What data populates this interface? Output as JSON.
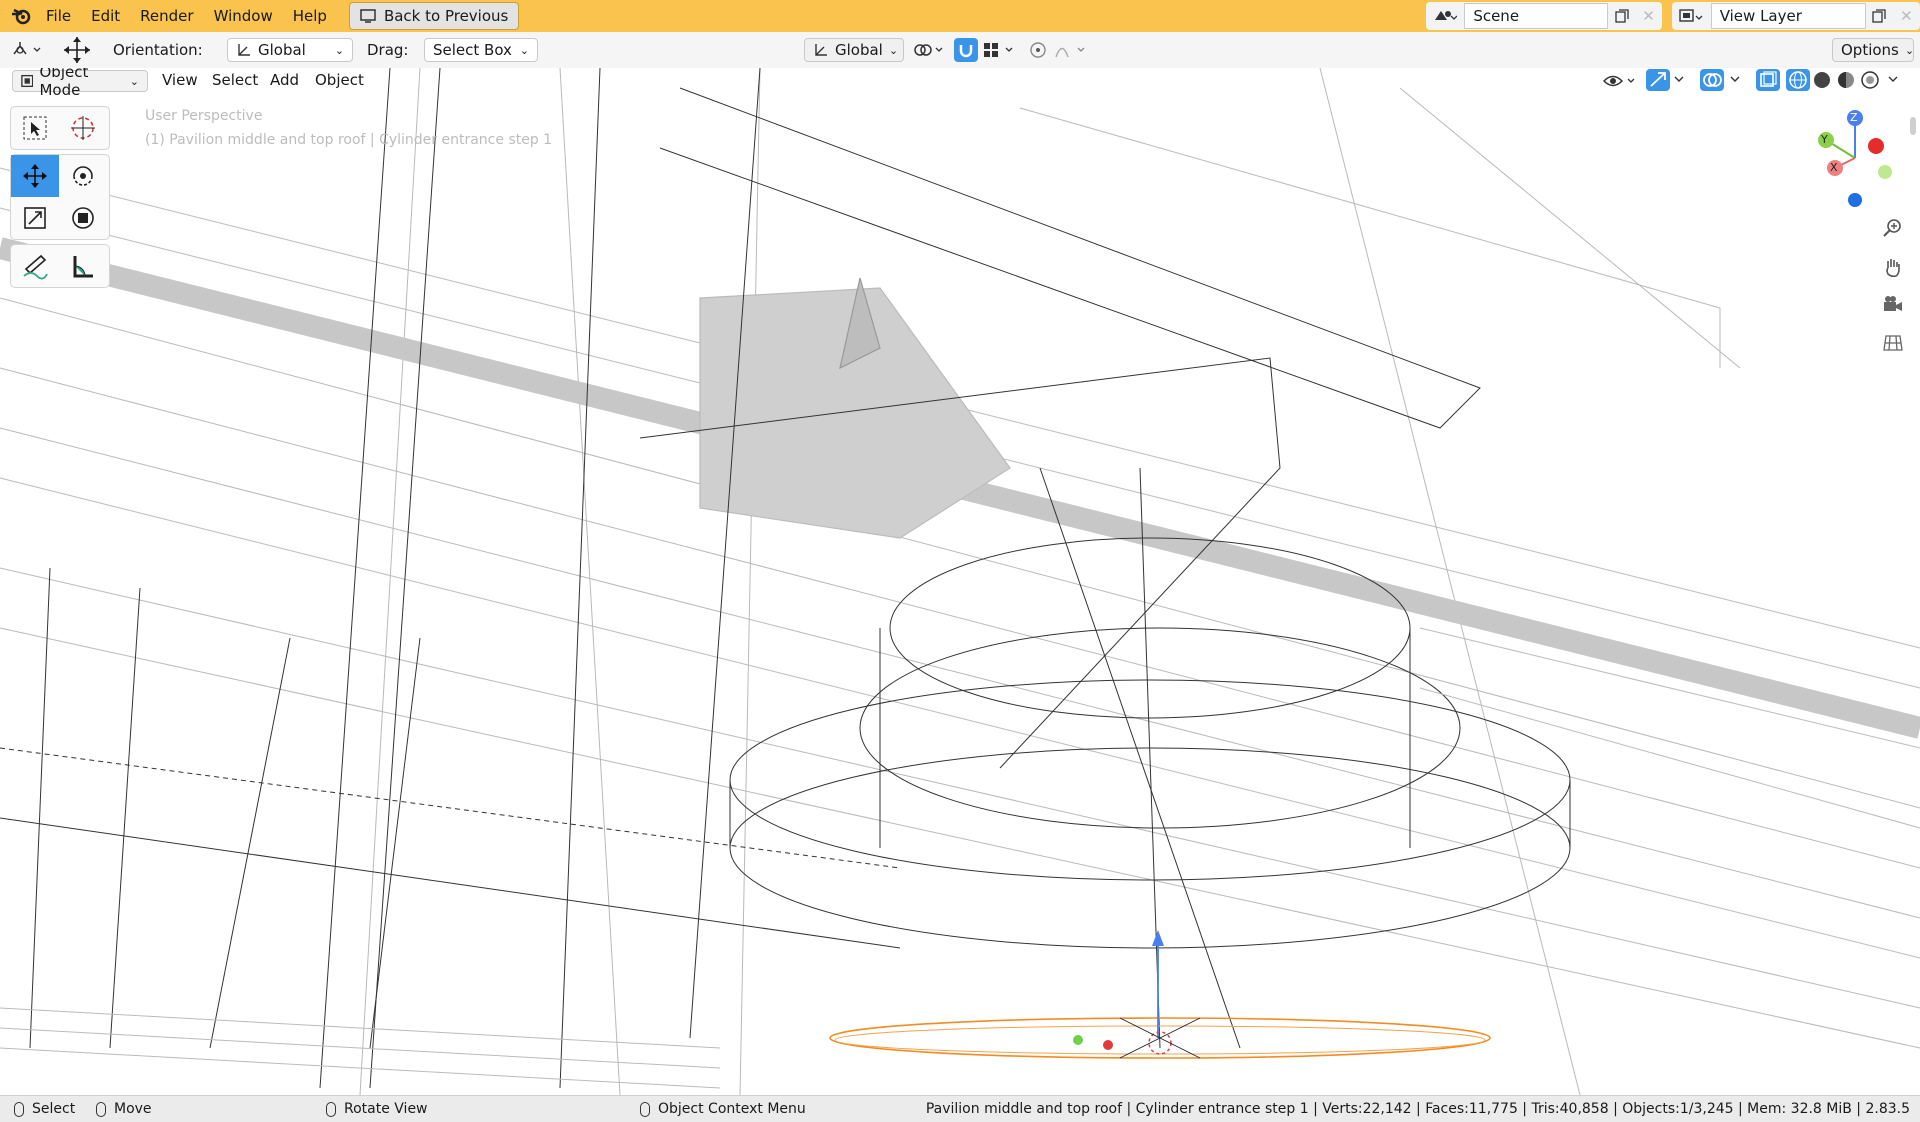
{
  "topbar": {
    "menus": [
      "File",
      "Edit",
      "Render",
      "Window",
      "Help"
    ],
    "back_label": "Back to Previous",
    "scene_value": "Scene",
    "view_layer_value": "View Layer",
    "accent_color": "#f9c34e"
  },
  "toolbar": {
    "orientation_label": "Orientation:",
    "orientation_value": "Global",
    "drag_label": "Drag:",
    "drag_value": "Select Box",
    "transform_orientation_value": "Global",
    "options_label": "Options"
  },
  "header": {
    "mode_value": "Object Mode",
    "menus": [
      "View",
      "Select",
      "Add",
      "Object"
    ]
  },
  "viewport": {
    "perspective_text": "User Perspective",
    "collection_text": "(1) Pavilion middle and top roof | Cylinder entrance step 1",
    "gizmo_axes": [
      "Z",
      "Y",
      "X"
    ]
  },
  "statusbar": {
    "select_label": "Select",
    "move_label": "Move",
    "rotate_label": "Rotate View",
    "context_label": "Object Context Menu",
    "stats": "Pavilion middle and top roof | Cylinder entrance step 1 | Verts:22,142 | Faces:11,775 | Tris:40,858 | Objects:1/3,245 | Mem: 32.8 MiB | 2.83.5"
  }
}
